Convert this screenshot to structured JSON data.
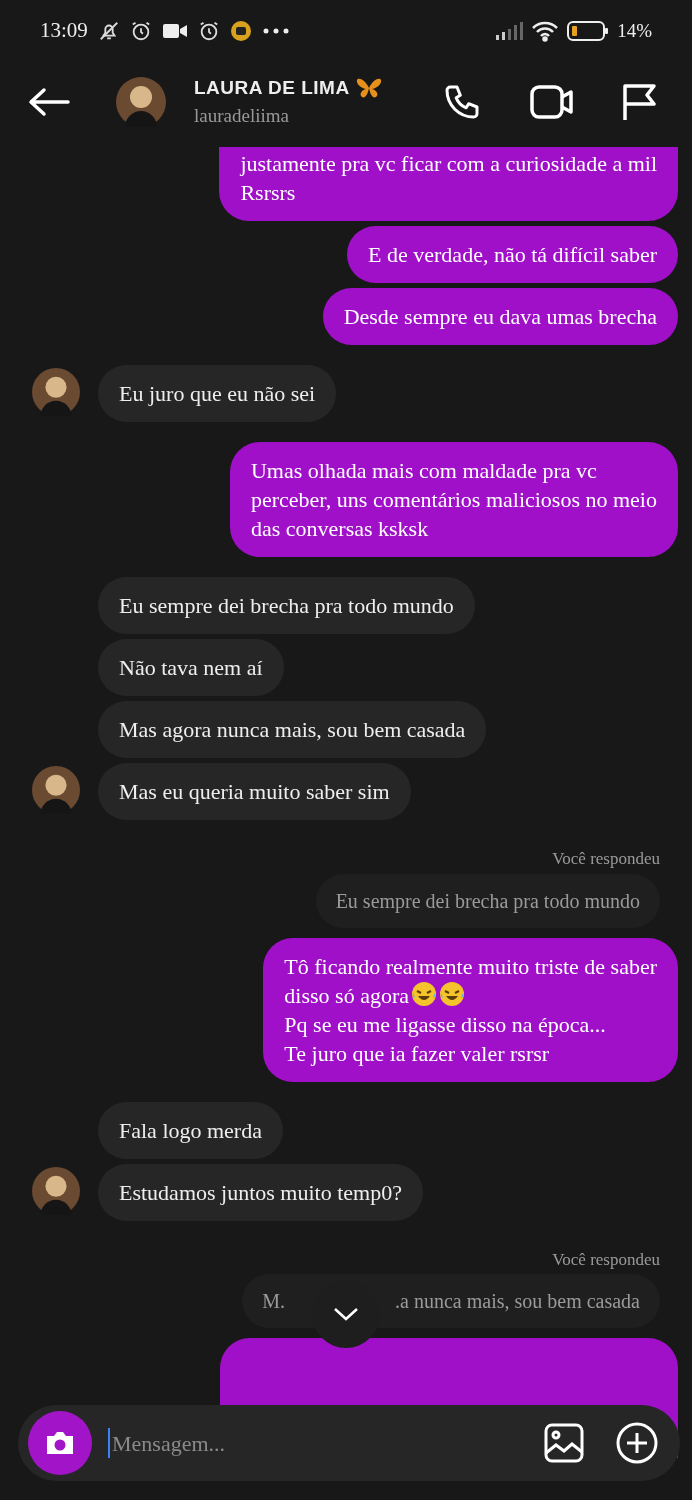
{
  "status_bar": {
    "time": "13:09",
    "battery_text": "14%"
  },
  "header": {
    "name": "LAURA DE LIMA",
    "username": "lauradeliima"
  },
  "messages": [
    {
      "kind": "outgoing",
      "top_cut": true,
      "lines": [
        [
          {
            "kind": "text",
            "text": "justamente pra vc ficar com a curiosidade a mil"
          }
        ],
        [
          {
            "kind": "text",
            "text": "Rsrsrs"
          }
        ]
      ]
    },
    {
      "kind": "outgoing",
      "lines": [
        [
          {
            "kind": "text",
            "text": "E de verdade, não tá difícil saber"
          }
        ]
      ]
    },
    {
      "kind": "outgoing",
      "lines": [
        [
          {
            "kind": "text",
            "text": "Desde sempre eu dava umas brecha"
          }
        ]
      ]
    },
    {
      "kind": "incoming",
      "avatar": true,
      "lines": [
        [
          {
            "kind": "text",
            "text": "Eu juro que eu não sei"
          }
        ]
      ]
    },
    {
      "kind": "outgoing",
      "lines": [
        [
          {
            "kind": "text",
            "text": "Umas olhada mais com maldade pra vc"
          }
        ],
        [
          {
            "kind": "text",
            "text": "perceber, uns comentários maliciosos no meio"
          }
        ],
        [
          {
            "kind": "text",
            "text": "das conversas ksksk"
          }
        ]
      ]
    },
    {
      "kind": "incoming",
      "avatar": false,
      "lines": [
        [
          {
            "kind": "text",
            "text": "Eu sempre dei brecha pra todo mundo"
          }
        ]
      ]
    },
    {
      "kind": "incoming",
      "avatar": false,
      "lines": [
        [
          {
            "kind": "text",
            "text": "Não tava nem aí"
          }
        ]
      ]
    },
    {
      "kind": "incoming",
      "avatar": false,
      "lines": [
        [
          {
            "kind": "text",
            "text": "Mas agora nunca mais, sou bem casada"
          }
        ]
      ]
    },
    {
      "kind": "incoming",
      "avatar": true,
      "lines": [
        [
          {
            "kind": "text",
            "text": "Mas eu queria muito saber sim"
          }
        ]
      ]
    },
    {
      "kind": "reply_label",
      "text": "Você respondeu"
    },
    {
      "kind": "reply_quote",
      "parts": [
        "Eu sempre dei brecha pra todo mundo"
      ]
    },
    {
      "kind": "outgoing",
      "lines": [
        [
          {
            "kind": "text",
            "text": "Tô ficando realmente muito triste de saber"
          }
        ],
        [
          {
            "kind": "text",
            "text": "disso só agora"
          },
          {
            "kind": "laugh_emoji"
          },
          {
            "kind": "laugh_emoji"
          }
        ],
        [
          {
            "kind": "text",
            "text": "Pq se eu me ligasse disso na época..."
          }
        ],
        [
          {
            "kind": "text",
            "text": "Te juro que ia fazer valer rsrsr"
          }
        ]
      ]
    },
    {
      "kind": "incoming",
      "avatar": false,
      "lines": [
        [
          {
            "kind": "text",
            "text": "Fala logo merda"
          }
        ]
      ]
    },
    {
      "kind": "incoming",
      "avatar": true,
      "lines": [
        [
          {
            "kind": "text",
            "text": "Estudamos juntos muito temp0?"
          }
        ]
      ]
    },
    {
      "kind": "reply_label",
      "text": "Você respondeu"
    },
    {
      "kind": "reply_quote",
      "parts": [
        "M.",
        ".a nunca mais, sou bem casada"
      ]
    },
    {
      "kind": "cut_bubble"
    }
  ],
  "composer": {
    "placeholder": "Mensagem..."
  }
}
